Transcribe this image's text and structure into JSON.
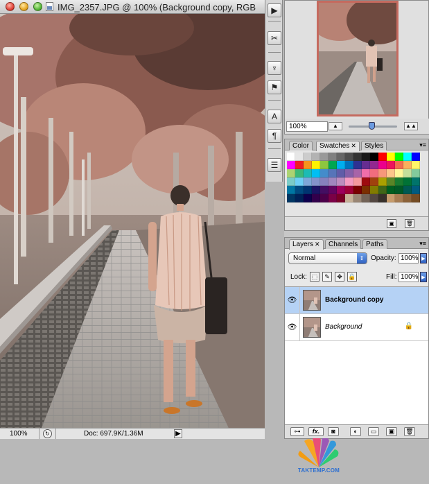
{
  "document": {
    "title": "IMG_2357.JPG @ 100% (Background copy, RGB",
    "zoom": "100%",
    "doc_info": "Doc: 697.9K/1.36M"
  },
  "toolstrip": {
    "icons": [
      "play-icon",
      "tools-icon",
      "brush-icon",
      "stamp-icon",
      "character-icon",
      "paragraph-icon",
      "layer-comps-icon"
    ]
  },
  "navigator": {
    "zoom": "100%",
    "zoom_level": 0.48
  },
  "swatches_panel": {
    "tabs": [
      "Color",
      "Swatches",
      "Styles"
    ],
    "active_tab": "Swatches",
    "colors": [
      "#ffffff",
      "#e6e6e6",
      "#cccccc",
      "#b3b3b3",
      "#999999",
      "#808080",
      "#666666",
      "#4d4d4d",
      "#333333",
      "#1a1a1a",
      "#000000",
      "#ff0000",
      "#ffff00",
      "#00ff00",
      "#00ffff",
      "#0000ff",
      "#ff00ff",
      "#ee1d24",
      "#f7941d",
      "#fff200",
      "#8dc63f",
      "#00a651",
      "#00aeef",
      "#0072bc",
      "#2e3192",
      "#662d91",
      "#92278f",
      "#ec008c",
      "#ed145b",
      "#f26c4f",
      "#fbaf5d",
      "#fff568",
      "#acd373",
      "#3cb878",
      "#1cbbb4",
      "#00bff3",
      "#448ccb",
      "#5674b9",
      "#605ca8",
      "#855fa8",
      "#a864a8",
      "#f06eaa",
      "#f26d7d",
      "#f7977a",
      "#fdc68a",
      "#fff79a",
      "#c4df9b",
      "#82ca9c",
      "#7accc8",
      "#6dcff6",
      "#7da7d9",
      "#8393ca",
      "#8781bd",
      "#a186be",
      "#bd8cbf",
      "#f49ac1",
      "#f5989d",
      "#9e0b0f",
      "#a0410d",
      "#aba000",
      "#598527",
      "#197b30",
      "#007236",
      "#00746b",
      "#0076a3",
      "#004a80",
      "#003471",
      "#1b1464",
      "#440e62",
      "#630460",
      "#9e005d",
      "#9e0039",
      "#790000",
      "#7b2e00",
      "#827b00",
      "#406618",
      "#005e20",
      "#005826",
      "#005952",
      "#005b7f",
      "#003663",
      "#002157",
      "#0d004c",
      "#32004b",
      "#4b0049",
      "#7b0046",
      "#7a0026",
      "#c7b299",
      "#998675",
      "#736357",
      "#534741",
      "#37302a",
      "#c69c6d",
      "#a67c52",
      "#8c6239",
      "#754c24"
    ]
  },
  "layers_panel": {
    "tabs": [
      "Layers",
      "Channels",
      "Paths"
    ],
    "active_tab": "Layers",
    "blend_mode": "Normal",
    "opacity_label": "Opacity:",
    "opacity_value": "100%",
    "lock_label": "Lock:",
    "fill_label": "Fill:",
    "fill_value": "100%",
    "layers": [
      {
        "name": "Background copy",
        "selected": true,
        "visible": true
      },
      {
        "name": "Background",
        "selected": false,
        "visible": true,
        "locked": true
      }
    ],
    "footer_labels": {
      "fx": "fx."
    }
  },
  "watermark": {
    "text": "TAKTEMP.COM"
  }
}
